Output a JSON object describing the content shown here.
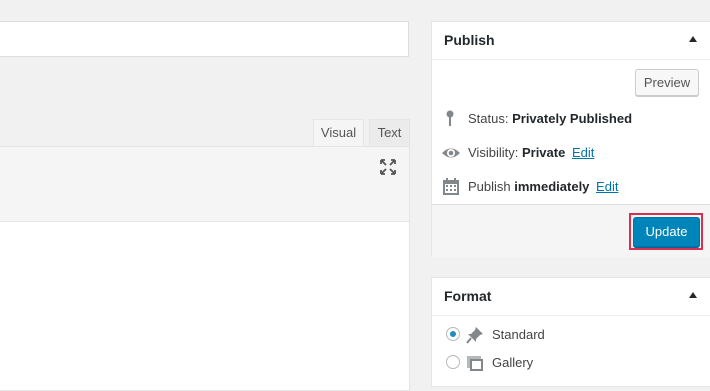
{
  "editor": {
    "tab_visual": "Visual",
    "tab_text": "Text"
  },
  "publish": {
    "title": "Publish",
    "preview_label": "Preview",
    "status_label": "Status:",
    "status_value": "Privately Published",
    "visibility_label": "Visibility:",
    "visibility_value": "Private",
    "visibility_edit": "Edit",
    "publish_label": "Publish",
    "publish_value": "immediately",
    "publish_edit": "Edit",
    "update_label": "Update"
  },
  "format": {
    "title": "Format",
    "options": [
      {
        "label": "Standard",
        "selected": true,
        "icon": "pin-icon"
      },
      {
        "label": "Gallery",
        "selected": false,
        "icon": "gallery-icon"
      }
    ]
  },
  "colors": {
    "accent": "#0085ba",
    "link": "#0073aa",
    "highlight": "#d63053"
  }
}
